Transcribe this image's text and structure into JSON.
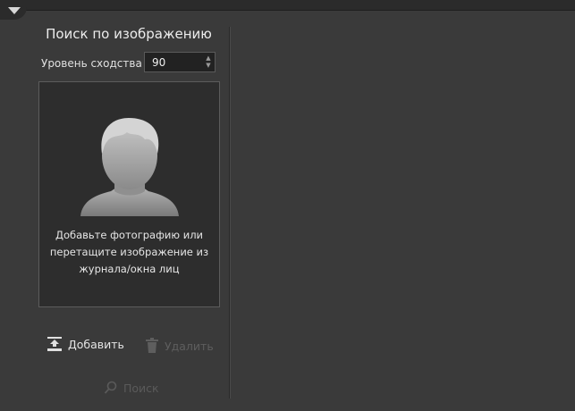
{
  "panel": {
    "title": "Поиск по изображению",
    "similarity": {
      "label": "Уровень сходства",
      "value": "90"
    },
    "dropzone": {
      "text": "Добавьте фотографию или перетащите изображение из журнала/окна лиц"
    },
    "buttons": {
      "add": "Добавить",
      "delete": "Удалить",
      "search": "Поиск"
    }
  },
  "icons": {
    "toggle": "chevron-down-icon",
    "add": "upload-icon",
    "delete": "trash-icon",
    "search": "search-icon"
  },
  "colors": {
    "background": "#3a3a3a",
    "dropzone": "#2d2d2d",
    "text": "#e6e6e6",
    "disabled": "#5e5e5e"
  }
}
